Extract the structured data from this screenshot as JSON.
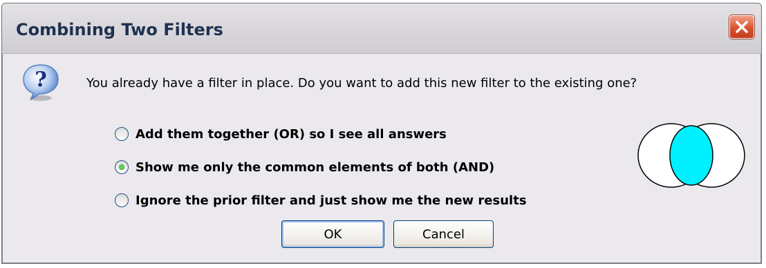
{
  "dialog": {
    "title": "Combining Two Filters",
    "message": "You already have a filter in place.  Do you want to add this new filter to the existing one?",
    "options": [
      {
        "label": "Add them together (OR) so I see all answers",
        "selected": false
      },
      {
        "label": "Show me only the common elements of both (AND)",
        "selected": true
      },
      {
        "label": "Ignore the prior filter and just show me the new results",
        "selected": false
      }
    ],
    "buttons": {
      "ok": "OK",
      "cancel": "Cancel"
    },
    "icons": {
      "close": "close-icon",
      "question": "question-icon",
      "venn": "venn-diagram-icon"
    },
    "colors": {
      "titleText": "#1f3150",
      "closeButton": "#d9542f",
      "vennFill": "#00f0ff"
    }
  }
}
